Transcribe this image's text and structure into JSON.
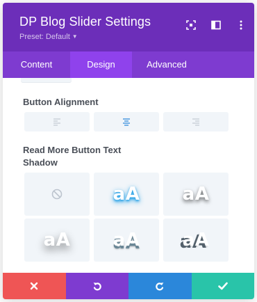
{
  "header": {
    "title": "DP Blog Slider Settings",
    "preset": "Preset: Default",
    "icons": [
      "focus-icon",
      "split-view-icon",
      "more-options-icon"
    ]
  },
  "tabs": [
    {
      "label": "Content",
      "active": false
    },
    {
      "label": "Design",
      "active": true
    },
    {
      "label": "Advanced",
      "active": false
    }
  ],
  "button_alignment": {
    "label": "Button Alignment",
    "options": [
      "align-left-icon",
      "align-center-icon",
      "align-right-icon"
    ],
    "selected": "align-center-icon"
  },
  "text_shadow": {
    "label": "Read More Button Text Shadow",
    "sample_text": "aA",
    "options": [
      "none",
      "shadow-blue-glow",
      "shadow-soft",
      "shadow-wide",
      "shadow-hard-bottom",
      "shadow-hard-left"
    ]
  },
  "footer": {
    "buttons": [
      "close-icon",
      "undo-icon",
      "redo-icon",
      "check-icon"
    ]
  },
  "colors": {
    "header": "#6c2eb9",
    "tabs": "#7e3bd0",
    "active_tab": "#8f42ec",
    "cancel": "#ef5555",
    "undo": "#7e3bd0",
    "redo": "#2b87da",
    "save": "#29c4a9",
    "selected_icon": "#2b87da"
  }
}
